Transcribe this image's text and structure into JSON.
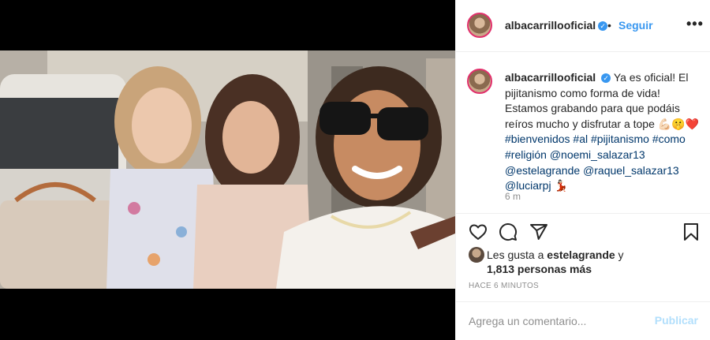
{
  "post": {
    "username": "albacarrillooficial",
    "verified_glyph": "✓",
    "separator": "•",
    "follow_label": "Seguir",
    "more_label": "•••"
  },
  "caption": {
    "username": "albacarrillooficial",
    "text_1": "Ya es oficial! El pijitanismo como forma de vida! Estamos grabando para que podáis reíros mucho y disfrutar a tope 💪🏻🤫❤️",
    "hashtag_bienvenidos": "#bienvenidos",
    "hashtag_al": "#al",
    "hashtag_pijitanismo": "#pijitanismo",
    "hashtag_como": "#como",
    "hashtag_religion": "#religión",
    "mention_noemi": "@noemi_salazar13",
    "mention_estela": "@estelagrande",
    "mention_raquel": "@raquel_salazar13",
    "mention_lucia": "@luciarpj",
    "emoji_end": "💃🏻",
    "relative_time": "6 m"
  },
  "likes": {
    "prefix": "Les gusta a",
    "liked_by": "estelagrande",
    "conjunction": "y",
    "others": "1,813 personas más"
  },
  "timestamp": "HACE 6 MINUTOS",
  "comment": {
    "placeholder": "Agrega un comentario...",
    "publish_label": "Publicar"
  },
  "icons": {
    "like": "heart-icon",
    "comment": "comment-bubble-icon",
    "share": "paper-plane-icon",
    "save": "bookmark-icon"
  },
  "colors": {
    "link": "#3897f0",
    "tag": "#00376b",
    "publish_disabled": "#b2dffc",
    "muted": "#8e8e8e"
  }
}
